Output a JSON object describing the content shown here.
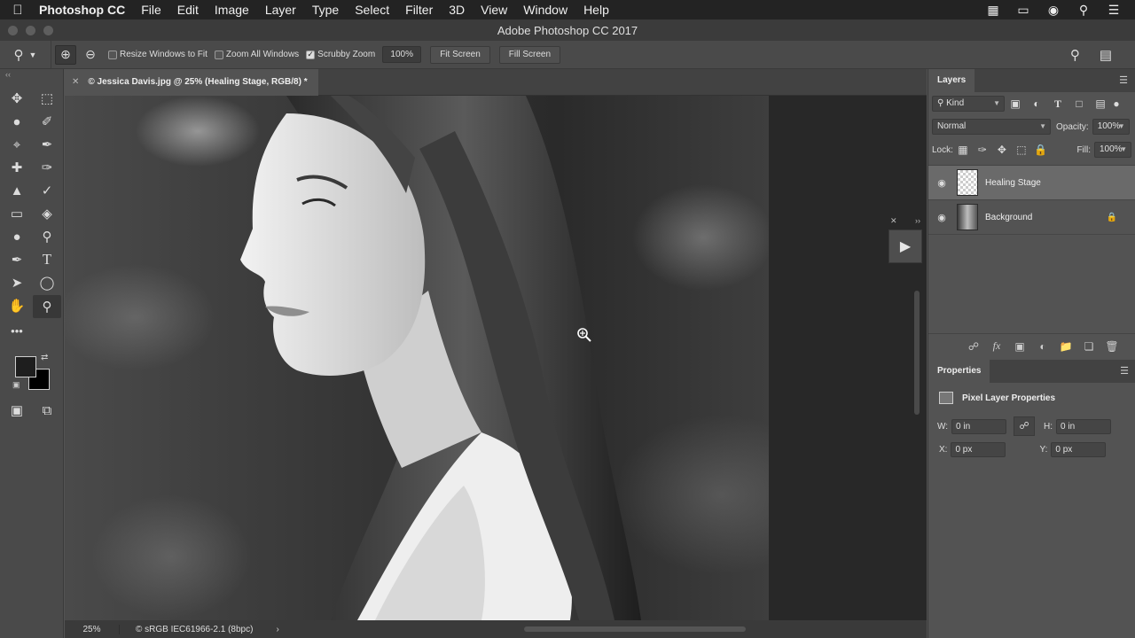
{
  "menubar": {
    "app": "Photoshop CC",
    "items": [
      "File",
      "Edit",
      "Image",
      "Layer",
      "Type",
      "Select",
      "Filter",
      "3D",
      "View",
      "Window",
      "Help"
    ],
    "status_icons": [
      "grid-icon",
      "airplay-icon",
      "camera-icon",
      "search-icon",
      "list-icon"
    ]
  },
  "window": {
    "title": "Adobe Photoshop CC 2017"
  },
  "options": {
    "resize_windows": "Resize Windows to Fit",
    "zoom_all": "Zoom All Windows",
    "scrubby": "Scrubby Zoom",
    "zoom_value": "100%",
    "fit_screen": "Fit Screen",
    "fill_screen": "Fill Screen",
    "resize_checked": false,
    "zoom_all_checked": false,
    "scrubby_checked": true
  },
  "document": {
    "tab_title": "© Jessica Davis.jpg @ 25% (Healing Stage, RGB/8) *",
    "zoom": "25%",
    "profile": "© sRGB IEC61966-2.1 (8bpc)"
  },
  "layers_panel": {
    "tab": "Layers",
    "filter_kind": "Kind",
    "blend_mode": "Normal",
    "opacity_label": "Opacity:",
    "opacity": "100%",
    "lock_label": "Lock:",
    "fill_label": "Fill:",
    "fill": "100%",
    "layers": [
      {
        "name": "Healing Stage",
        "selected": true,
        "locked": false
      },
      {
        "name": "Background",
        "selected": false,
        "locked": true
      }
    ]
  },
  "properties_panel": {
    "tab": "Properties",
    "heading": "Pixel Layer Properties",
    "w_label": "W:",
    "w_value": "0 in",
    "h_label": "H:",
    "h_value": "0 in",
    "x_label": "X:",
    "x_value": "0 px",
    "y_label": "Y:",
    "y_value": "0 px"
  }
}
